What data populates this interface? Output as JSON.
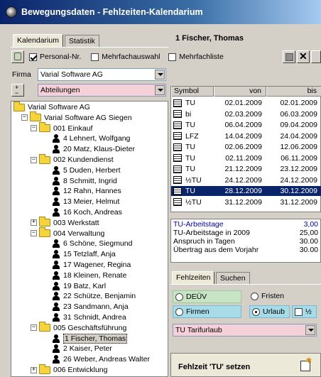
{
  "window": {
    "title": "Bewegungsdaten - Fehlzeiten-Kalendarium"
  },
  "left_tabs": [
    "Kalendarium",
    "Statistik"
  ],
  "employee_header": "1 Fischer, Thomas",
  "options": {
    "personal_nr": {
      "label": "Personal-Nr.",
      "checked": true
    },
    "mehrfachauswahl": {
      "label": "Mehrfachauswahl",
      "checked": false
    },
    "mehrfachliste": {
      "label": "Mehrfachliste",
      "checked": false
    }
  },
  "firma": {
    "label": "Firma",
    "value": "Varial Software AG"
  },
  "abteilungen": {
    "value": "Abteilungen"
  },
  "tree": [
    {
      "text": "Varial Software AG",
      "type": "folder",
      "level": 0
    },
    {
      "text": "Varial Software AG Siegen",
      "type": "folder",
      "level": 1,
      "expander": "-"
    },
    {
      "text": "001 Einkauf",
      "type": "folder",
      "level": 2,
      "expander": "-"
    },
    {
      "text": "4 Lehnert, Wolfgang",
      "type": "person",
      "level": 3
    },
    {
      "text": "20 Matz, Klaus-Dieter",
      "type": "person",
      "level": 3
    },
    {
      "text": "002 Kundendienst",
      "type": "folder",
      "level": 2,
      "expander": "-"
    },
    {
      "text": "5 Duden, Herbert",
      "type": "person",
      "level": 3
    },
    {
      "text": "8 Schmitt, Ingrid",
      "type": "person",
      "level": 3
    },
    {
      "text": "12 Rahn, Hannes",
      "type": "person",
      "level": 3
    },
    {
      "text": "13 Meier, Helmut",
      "type": "person",
      "level": 3
    },
    {
      "text": "16 Koch, Andreas",
      "type": "person",
      "level": 3
    },
    {
      "text": "003 Werkstatt",
      "type": "folder",
      "level": 2,
      "expander": "+"
    },
    {
      "text": "004 Verwaltung",
      "type": "folder",
      "level": 2,
      "expander": "-"
    },
    {
      "text": "6 Schöne, Siegmund",
      "type": "person",
      "level": 3
    },
    {
      "text": "15 Tetzlaff, Anja",
      "type": "person",
      "level": 3
    },
    {
      "text": "17 Wagener, Regina",
      "type": "person",
      "level": 3
    },
    {
      "text": "18 Kleinen, Renate",
      "type": "person",
      "level": 3
    },
    {
      "text": "19 Batz, Karl",
      "type": "person",
      "level": 3
    },
    {
      "text": "22 Schütze, Benjamin",
      "type": "person",
      "level": 3
    },
    {
      "text": "23 Sandmann, Anja",
      "type": "person",
      "level": 3
    },
    {
      "text": "31 Schnidt, Andrea",
      "type": "person",
      "level": 3
    },
    {
      "text": "005 Geschäftsführung",
      "type": "folder",
      "level": 2,
      "expander": "-"
    },
    {
      "text": "1 Fischer, Thomas",
      "type": "person",
      "level": 3,
      "selected": true
    },
    {
      "text": "2 Kaiser, Peter",
      "type": "person",
      "level": 3
    },
    {
      "text": "26 Weber, Andreas Walter",
      "type": "person",
      "level": 3
    },
    {
      "text": "006 Entwicklung",
      "type": "folder",
      "level": 2,
      "expander": "+"
    }
  ],
  "table": {
    "headers": [
      "Symbol",
      "von",
      "bis"
    ],
    "rows": [
      {
        "symbol": "TU",
        "von": "02.01.2009",
        "bis": "02.01.2009"
      },
      {
        "symbol": "bi",
        "von": "02.03.2009",
        "bis": "06.03.2009"
      },
      {
        "symbol": "TU",
        "von": "06.04.2009",
        "bis": "09.04.2009"
      },
      {
        "symbol": "LFZ",
        "von": "14.04.2009",
        "bis": "24.04.2009"
      },
      {
        "symbol": "TU",
        "von": "02.06.2009",
        "bis": "12.06.2009"
      },
      {
        "symbol": "TU",
        "von": "02.11.2009",
        "bis": "06.11.2009"
      },
      {
        "symbol": "TU",
        "von": "21.12.2009",
        "bis": "23.12.2009"
      },
      {
        "symbol": "½TU",
        "von": "24.12.2009",
        "bis": "24.12.2009"
      },
      {
        "symbol": "TU",
        "von": "28.12.2009",
        "bis": "30.12.2009",
        "selected": true
      },
      {
        "symbol": "½TU",
        "von": "31.12.2009",
        "bis": "31.12.2009"
      }
    ]
  },
  "summary": [
    {
      "label": "TU-Arbeitstage",
      "value": "3,00",
      "highlight": true
    },
    {
      "label": "TU-Arbeitstage in 2009",
      "value": "25,00"
    },
    {
      "label": "Anspruch in Tagen",
      "value": "30.00"
    },
    {
      "label": "Übertrag aus dem Vorjahr",
      "value": "30.00"
    }
  ],
  "bottom_tabs": [
    "Fehlzeiten",
    "Suchen"
  ],
  "radios": {
    "deuv": "DEÜV",
    "fristen": "Fristen",
    "firmen": "Firmen",
    "urlaub": "Urlaub",
    "half": "½"
  },
  "tarif": {
    "value": "TU Tarifurlaub"
  },
  "set_label": "Fehlzeit 'TU' setzen",
  "colors": {
    "title_start": "#0a246a",
    "selection": "#0a246a",
    "pink_field": "#f6d0d8",
    "green_field": "#c7e5c4",
    "cyan_field": "#a7dbe8",
    "summary_blue": "#0000c0"
  }
}
